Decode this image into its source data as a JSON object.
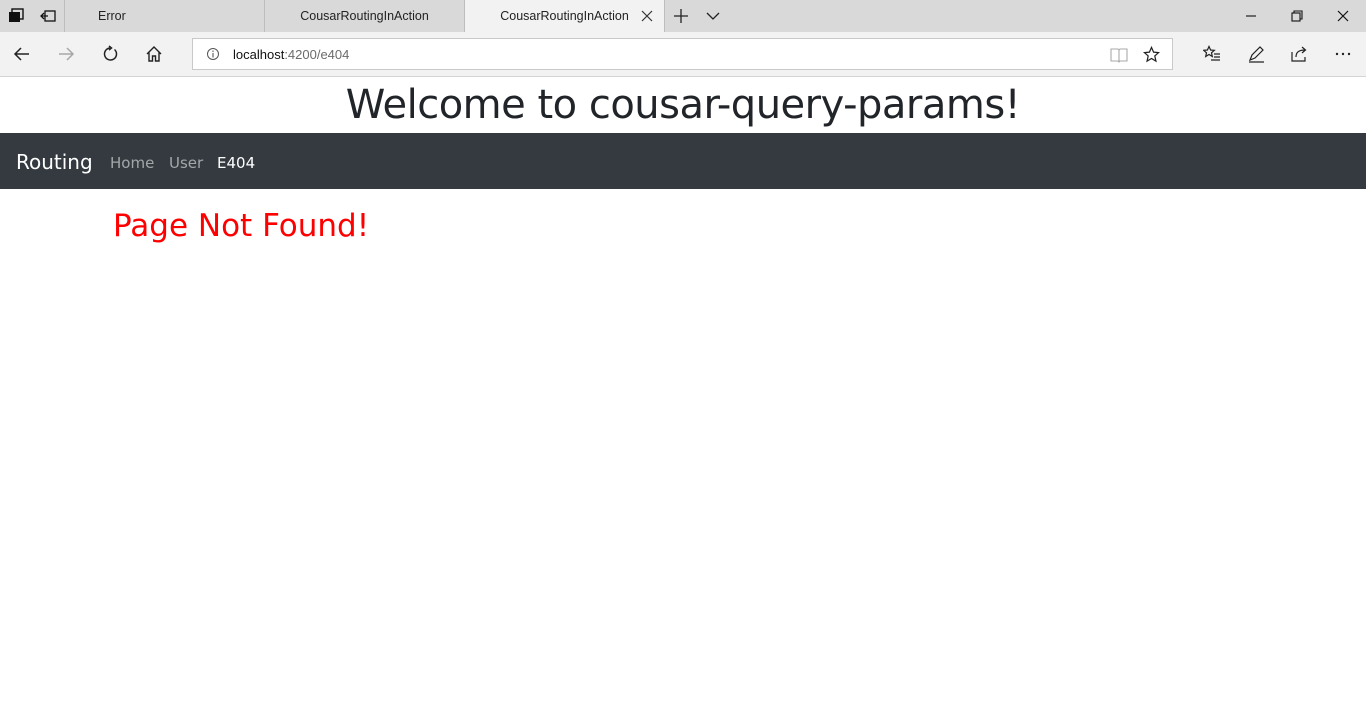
{
  "browser": {
    "tabs": [
      {
        "title": "Error",
        "active": false
      },
      {
        "title": "CousarRoutingInAction",
        "active": false
      },
      {
        "title": "CousarRoutingInAction",
        "active": true
      }
    ],
    "address": {
      "host": "localhost",
      "rest": ":4200/e404"
    },
    "icons": {
      "tab_set_aside": "tabs-aside-icon",
      "tab_preview": "tab-preview-icon",
      "new_tab": "plus-icon",
      "tab_list": "chevron-down-icon",
      "minimize": "minimize-icon",
      "restore": "restore-icon",
      "close": "close-icon",
      "back": "back-arrow-icon",
      "forward": "forward-arrow-icon",
      "refresh": "refresh-icon",
      "home": "home-icon",
      "site_info": "info-icon",
      "reading_view": "book-icon",
      "favorite": "star-icon",
      "favorites_hub": "favorites-list-icon",
      "notes": "pen-icon",
      "share": "share-icon",
      "more": "more-icon"
    }
  },
  "page": {
    "heading": "Welcome to cousar-query-params!",
    "nav": {
      "brand": "Routing",
      "links": [
        {
          "label": "Home",
          "active": false
        },
        {
          "label": "User",
          "active": false
        },
        {
          "label": "E404",
          "active": true
        }
      ],
      "background": "#343a40"
    },
    "message": "Page Not Found!",
    "message_color": "#ff0000"
  }
}
